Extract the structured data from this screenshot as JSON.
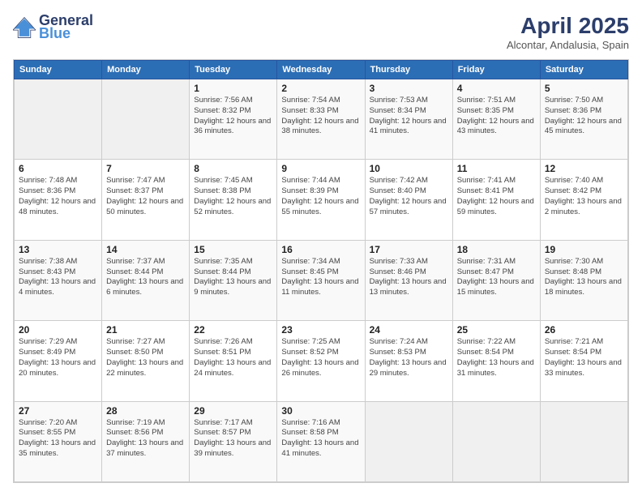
{
  "logo": {
    "line1": "General",
    "line2": "Blue"
  },
  "title": "April 2025",
  "location": "Alcontar, Andalusia, Spain",
  "weekdays": [
    "Sunday",
    "Monday",
    "Tuesday",
    "Wednesday",
    "Thursday",
    "Friday",
    "Saturday"
  ],
  "weeks": [
    [
      {
        "day": "",
        "sunrise": "",
        "sunset": "",
        "daylight": ""
      },
      {
        "day": "",
        "sunrise": "",
        "sunset": "",
        "daylight": ""
      },
      {
        "day": "1",
        "sunrise": "Sunrise: 7:56 AM",
        "sunset": "Sunset: 8:32 PM",
        "daylight": "Daylight: 12 hours and 36 minutes."
      },
      {
        "day": "2",
        "sunrise": "Sunrise: 7:54 AM",
        "sunset": "Sunset: 8:33 PM",
        "daylight": "Daylight: 12 hours and 38 minutes."
      },
      {
        "day": "3",
        "sunrise": "Sunrise: 7:53 AM",
        "sunset": "Sunset: 8:34 PM",
        "daylight": "Daylight: 12 hours and 41 minutes."
      },
      {
        "day": "4",
        "sunrise": "Sunrise: 7:51 AM",
        "sunset": "Sunset: 8:35 PM",
        "daylight": "Daylight: 12 hours and 43 minutes."
      },
      {
        "day": "5",
        "sunrise": "Sunrise: 7:50 AM",
        "sunset": "Sunset: 8:36 PM",
        "daylight": "Daylight: 12 hours and 45 minutes."
      }
    ],
    [
      {
        "day": "6",
        "sunrise": "Sunrise: 7:48 AM",
        "sunset": "Sunset: 8:36 PM",
        "daylight": "Daylight: 12 hours and 48 minutes."
      },
      {
        "day": "7",
        "sunrise": "Sunrise: 7:47 AM",
        "sunset": "Sunset: 8:37 PM",
        "daylight": "Daylight: 12 hours and 50 minutes."
      },
      {
        "day": "8",
        "sunrise": "Sunrise: 7:45 AM",
        "sunset": "Sunset: 8:38 PM",
        "daylight": "Daylight: 12 hours and 52 minutes."
      },
      {
        "day": "9",
        "sunrise": "Sunrise: 7:44 AM",
        "sunset": "Sunset: 8:39 PM",
        "daylight": "Daylight: 12 hours and 55 minutes."
      },
      {
        "day": "10",
        "sunrise": "Sunrise: 7:42 AM",
        "sunset": "Sunset: 8:40 PM",
        "daylight": "Daylight: 12 hours and 57 minutes."
      },
      {
        "day": "11",
        "sunrise": "Sunrise: 7:41 AM",
        "sunset": "Sunset: 8:41 PM",
        "daylight": "Daylight: 12 hours and 59 minutes."
      },
      {
        "day": "12",
        "sunrise": "Sunrise: 7:40 AM",
        "sunset": "Sunset: 8:42 PM",
        "daylight": "Daylight: 13 hours and 2 minutes."
      }
    ],
    [
      {
        "day": "13",
        "sunrise": "Sunrise: 7:38 AM",
        "sunset": "Sunset: 8:43 PM",
        "daylight": "Daylight: 13 hours and 4 minutes."
      },
      {
        "day": "14",
        "sunrise": "Sunrise: 7:37 AM",
        "sunset": "Sunset: 8:44 PM",
        "daylight": "Daylight: 13 hours and 6 minutes."
      },
      {
        "day": "15",
        "sunrise": "Sunrise: 7:35 AM",
        "sunset": "Sunset: 8:44 PM",
        "daylight": "Daylight: 13 hours and 9 minutes."
      },
      {
        "day": "16",
        "sunrise": "Sunrise: 7:34 AM",
        "sunset": "Sunset: 8:45 PM",
        "daylight": "Daylight: 13 hours and 11 minutes."
      },
      {
        "day": "17",
        "sunrise": "Sunrise: 7:33 AM",
        "sunset": "Sunset: 8:46 PM",
        "daylight": "Daylight: 13 hours and 13 minutes."
      },
      {
        "day": "18",
        "sunrise": "Sunrise: 7:31 AM",
        "sunset": "Sunset: 8:47 PM",
        "daylight": "Daylight: 13 hours and 15 minutes."
      },
      {
        "day": "19",
        "sunrise": "Sunrise: 7:30 AM",
        "sunset": "Sunset: 8:48 PM",
        "daylight": "Daylight: 13 hours and 18 minutes."
      }
    ],
    [
      {
        "day": "20",
        "sunrise": "Sunrise: 7:29 AM",
        "sunset": "Sunset: 8:49 PM",
        "daylight": "Daylight: 13 hours and 20 minutes."
      },
      {
        "day": "21",
        "sunrise": "Sunrise: 7:27 AM",
        "sunset": "Sunset: 8:50 PM",
        "daylight": "Daylight: 13 hours and 22 minutes."
      },
      {
        "day": "22",
        "sunrise": "Sunrise: 7:26 AM",
        "sunset": "Sunset: 8:51 PM",
        "daylight": "Daylight: 13 hours and 24 minutes."
      },
      {
        "day": "23",
        "sunrise": "Sunrise: 7:25 AM",
        "sunset": "Sunset: 8:52 PM",
        "daylight": "Daylight: 13 hours and 26 minutes."
      },
      {
        "day": "24",
        "sunrise": "Sunrise: 7:24 AM",
        "sunset": "Sunset: 8:53 PM",
        "daylight": "Daylight: 13 hours and 29 minutes."
      },
      {
        "day": "25",
        "sunrise": "Sunrise: 7:22 AM",
        "sunset": "Sunset: 8:54 PM",
        "daylight": "Daylight: 13 hours and 31 minutes."
      },
      {
        "day": "26",
        "sunrise": "Sunrise: 7:21 AM",
        "sunset": "Sunset: 8:54 PM",
        "daylight": "Daylight: 13 hours and 33 minutes."
      }
    ],
    [
      {
        "day": "27",
        "sunrise": "Sunrise: 7:20 AM",
        "sunset": "Sunset: 8:55 PM",
        "daylight": "Daylight: 13 hours and 35 minutes."
      },
      {
        "day": "28",
        "sunrise": "Sunrise: 7:19 AM",
        "sunset": "Sunset: 8:56 PM",
        "daylight": "Daylight: 13 hours and 37 minutes."
      },
      {
        "day": "29",
        "sunrise": "Sunrise: 7:17 AM",
        "sunset": "Sunset: 8:57 PM",
        "daylight": "Daylight: 13 hours and 39 minutes."
      },
      {
        "day": "30",
        "sunrise": "Sunrise: 7:16 AM",
        "sunset": "Sunset: 8:58 PM",
        "daylight": "Daylight: 13 hours and 41 minutes."
      },
      {
        "day": "",
        "sunrise": "",
        "sunset": "",
        "daylight": ""
      },
      {
        "day": "",
        "sunrise": "",
        "sunset": "",
        "daylight": ""
      },
      {
        "day": "",
        "sunrise": "",
        "sunset": "",
        "daylight": ""
      }
    ]
  ]
}
